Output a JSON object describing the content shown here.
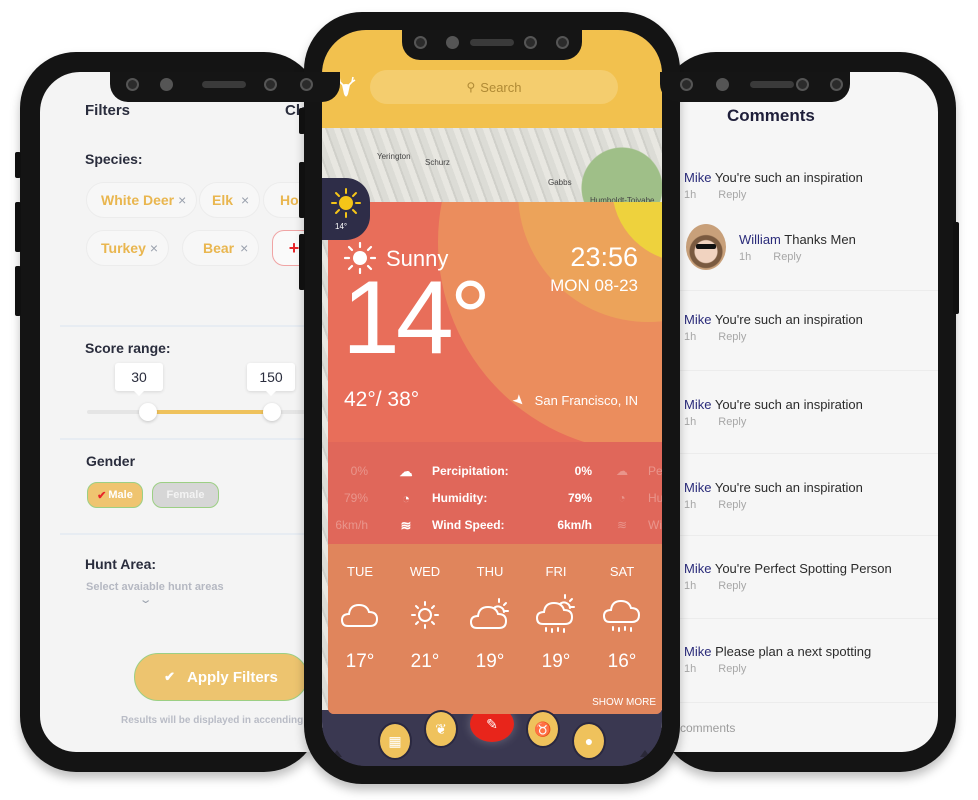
{
  "filters": {
    "title": "Filters",
    "clear_label": "Clear",
    "species_label": "Species:",
    "species": [
      {
        "label": "White Deer",
        "remove_icon": "×"
      },
      {
        "label": "Elk",
        "remove_icon": "×"
      },
      {
        "label": "Hog",
        "remove_icon": ""
      },
      {
        "label": "Turkey",
        "remove_icon": "×"
      },
      {
        "label": "Bear",
        "remove_icon": "×"
      }
    ],
    "add_species_icon": "+",
    "score_range_label": "Score range:",
    "score_min": "30",
    "score_max": "150",
    "gender_label": "Gender",
    "gender_options": [
      {
        "label": "Male",
        "selected": true,
        "check_icon": "✔"
      },
      {
        "label": "Female",
        "selected": false
      }
    ],
    "hunt_area_label": "Hunt Area:",
    "hunt_area_placeholder": "Select avaiable hunt areas",
    "hunt_area_chevron": "⌄",
    "apply_label": "Apply Filters",
    "apply_icon": "✔",
    "results_note": "Results will be displayed in accending order",
    "accent_color": "#efc25c"
  },
  "weather": {
    "search_placeholder": "Search",
    "search_icon": "⚲",
    "map_labels": [
      "Yerington",
      "Schurz",
      "Gabbs",
      "Humboldt-Toiyabe"
    ],
    "badge_temp": "14°",
    "condition": "Sunny",
    "temperature": "14°",
    "high_low": "42°/ 38°",
    "time": "23:56",
    "date": "MON  08-23",
    "location": "San Francisco, IN",
    "stats": [
      {
        "label": "Percipitation:",
        "value": "0%",
        "icon": "cloud-rain-icon",
        "glyph": "☁"
      },
      {
        "label": "Humidity:",
        "value": "79%",
        "icon": "humidity-gauge-icon",
        "glyph": "◔"
      },
      {
        "label": "Wind Speed:",
        "value": "6km/h",
        "icon": "wind-icon",
        "glyph": "≋"
      }
    ],
    "stats_ghost_right": [
      "Pe",
      "Hu",
      "Wi"
    ],
    "forecast": [
      {
        "day": "TUE",
        "temp": "17°",
        "icon": "cloud"
      },
      {
        "day": "WED",
        "temp": "21°",
        "icon": "sun"
      },
      {
        "day": "THU",
        "temp": "19°",
        "icon": "partly-cloudy"
      },
      {
        "day": "FRI",
        "temp": "19°",
        "icon": "partly-cloudy-rain"
      },
      {
        "day": "SAT",
        "temp": "16°",
        "icon": "cloud-rain"
      }
    ],
    "show_more_label": "SHOW MORE",
    "nav_items": [
      "map-download",
      "footprints",
      "record",
      "deer-head",
      "profile"
    ],
    "header_color": "#f2c14e",
    "card_color": "#e86e5a"
  },
  "comments": {
    "title": "Comments",
    "items": [
      {
        "name": "Mike",
        "text": "You're such an inspiration",
        "time": "1h",
        "reply": "Reply"
      },
      {
        "name": "William",
        "text": "Thanks Men",
        "time": "1h",
        "reply": "Reply",
        "has_avatar": true
      },
      {
        "name": "Mike",
        "text": "You're such an inspiration",
        "time": "1h",
        "reply": "Reply"
      },
      {
        "name": "Mike",
        "text": "You're such an inspiration",
        "time": "1h",
        "reply": "Reply"
      },
      {
        "name": "Mike",
        "text": "You're such an inspiration",
        "time": "1h",
        "reply": "Reply"
      },
      {
        "name": "Mike",
        "text": "You're Perfect Spotting Person",
        "time": "1h",
        "reply": "Reply"
      },
      {
        "name": "Mike",
        "text": "Please plan a next spotting",
        "time": "1h",
        "reply": "Reply"
      }
    ],
    "count_label": "comments"
  }
}
